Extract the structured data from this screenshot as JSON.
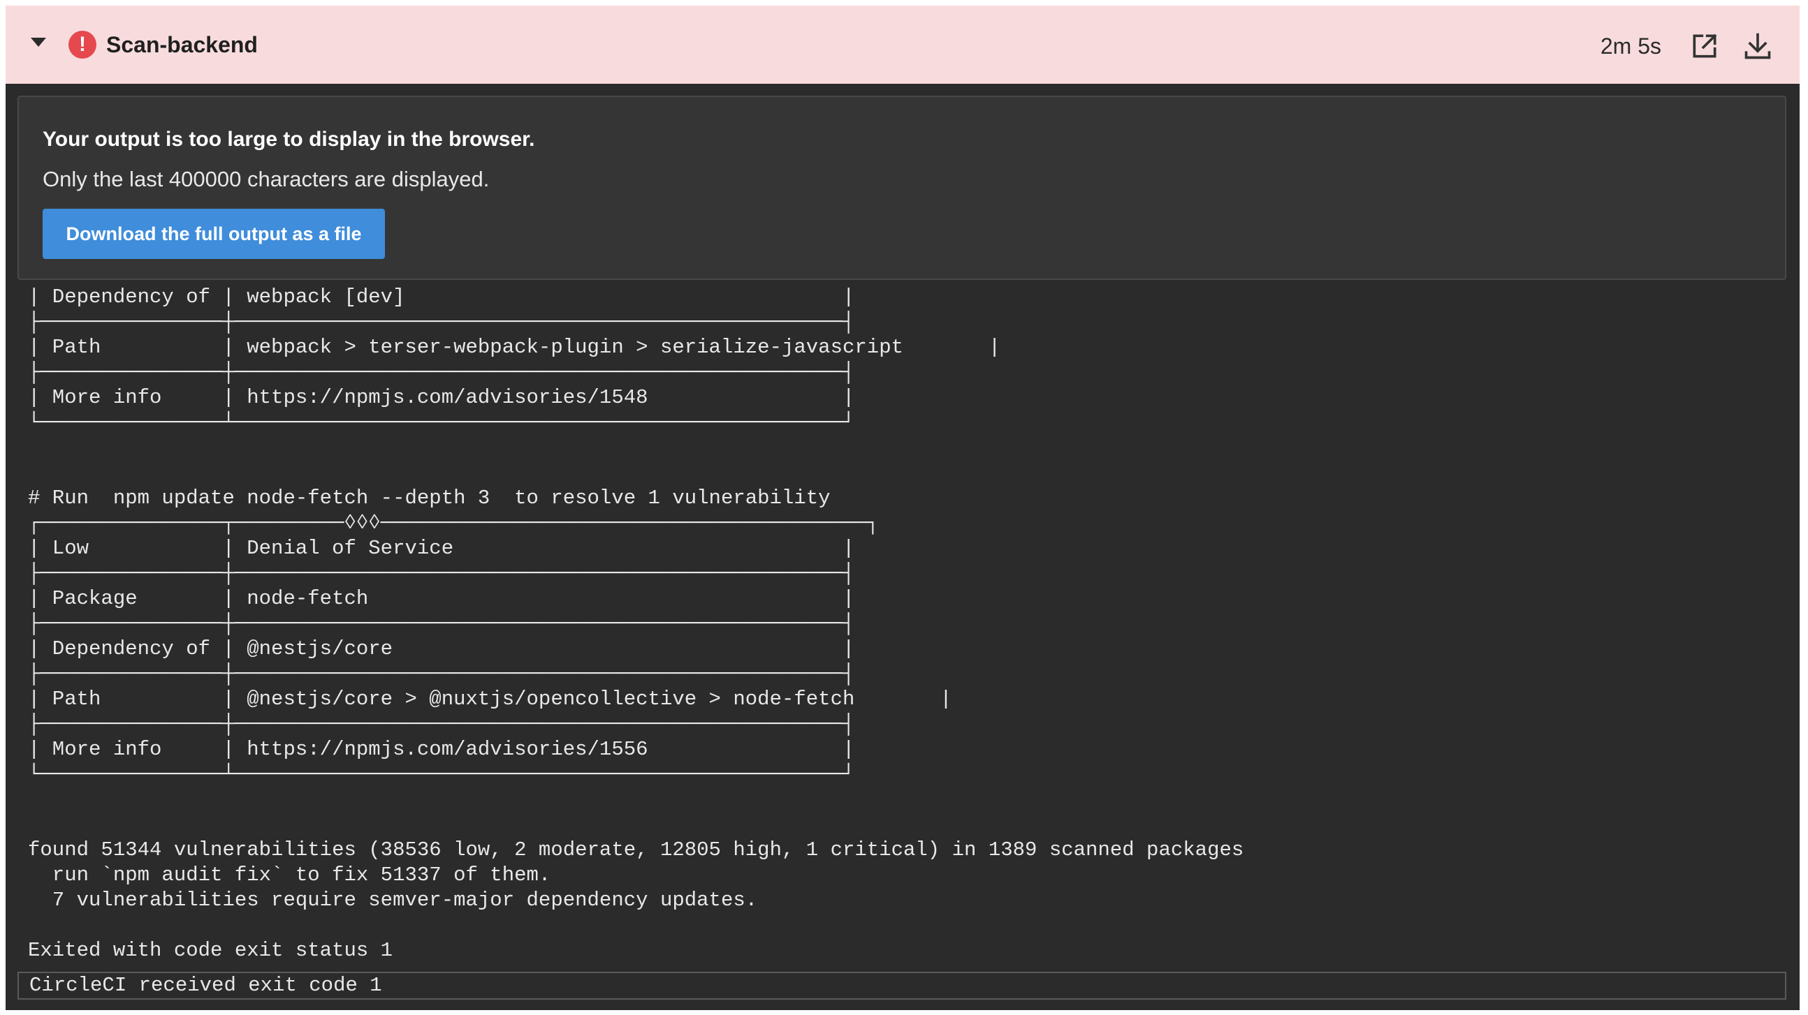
{
  "step": {
    "title": "Scan-backend",
    "duration": "2m 5s",
    "status_icon": "error-icon",
    "colors": {
      "header_background": "#f8dcdd",
      "error": "#e5484d",
      "terminal_background": "#2b2b2b",
      "button": "#3f8ddb"
    }
  },
  "notice": {
    "title": "Your output is too large to display in the browser.",
    "text": "Only the last 400000 characters are displayed.",
    "button_label": "Download the full output as a file"
  },
  "terminal": {
    "lines": [
      "| Dependency of | webpack [dev]                                    |",
      "├───────────────┼──────────────────────────────────────────────────┤",
      "| Path          | webpack > terser-webpack-plugin > serialize-javascript       |",
      "├───────────────┼──────────────────────────────────────────────────┤",
      "| More info     | https://npmjs.com/advisories/1548                |",
      "└───────────────┴──────────────────────────────────────────────────┘",
      "",
      "",
      "# Run  npm update node-fetch --depth 3  to resolve 1 vulnerability",
      "┌───────────────┬─────────◊◊◊────────────────────────────────────────┐",
      "| Low           | Denial of Service                                |",
      "├───────────────┼──────────────────────────────────────────────────┤",
      "| Package       | node-fetch                                       |",
      "├───────────────┼──────────────────────────────────────────────────┤",
      "| Dependency of | @nestjs/core                                     |",
      "├───────────────┼──────────────────────────────────────────────────┤",
      "| Path          | @nestjs/core > @nuxtjs/opencollective > node-fetch       |",
      "├───────────────┼──────────────────────────────────────────────────┤",
      "| More info     | https://npmjs.com/advisories/1556                |",
      "└───────────────┴──────────────────────────────────────────────────┘",
      "",
      "",
      "found 51344 vulnerabilities (38536 low, 2 moderate, 12805 high, 1 critical) in 1389 scanned packages",
      "  run `npm audit fix` to fix 51337 of them.",
      "  7 vulnerabilities require semver-major dependency updates.",
      "",
      "Exited with code exit status 1"
    ],
    "final_line": "CircleCI received exit code 1"
  }
}
